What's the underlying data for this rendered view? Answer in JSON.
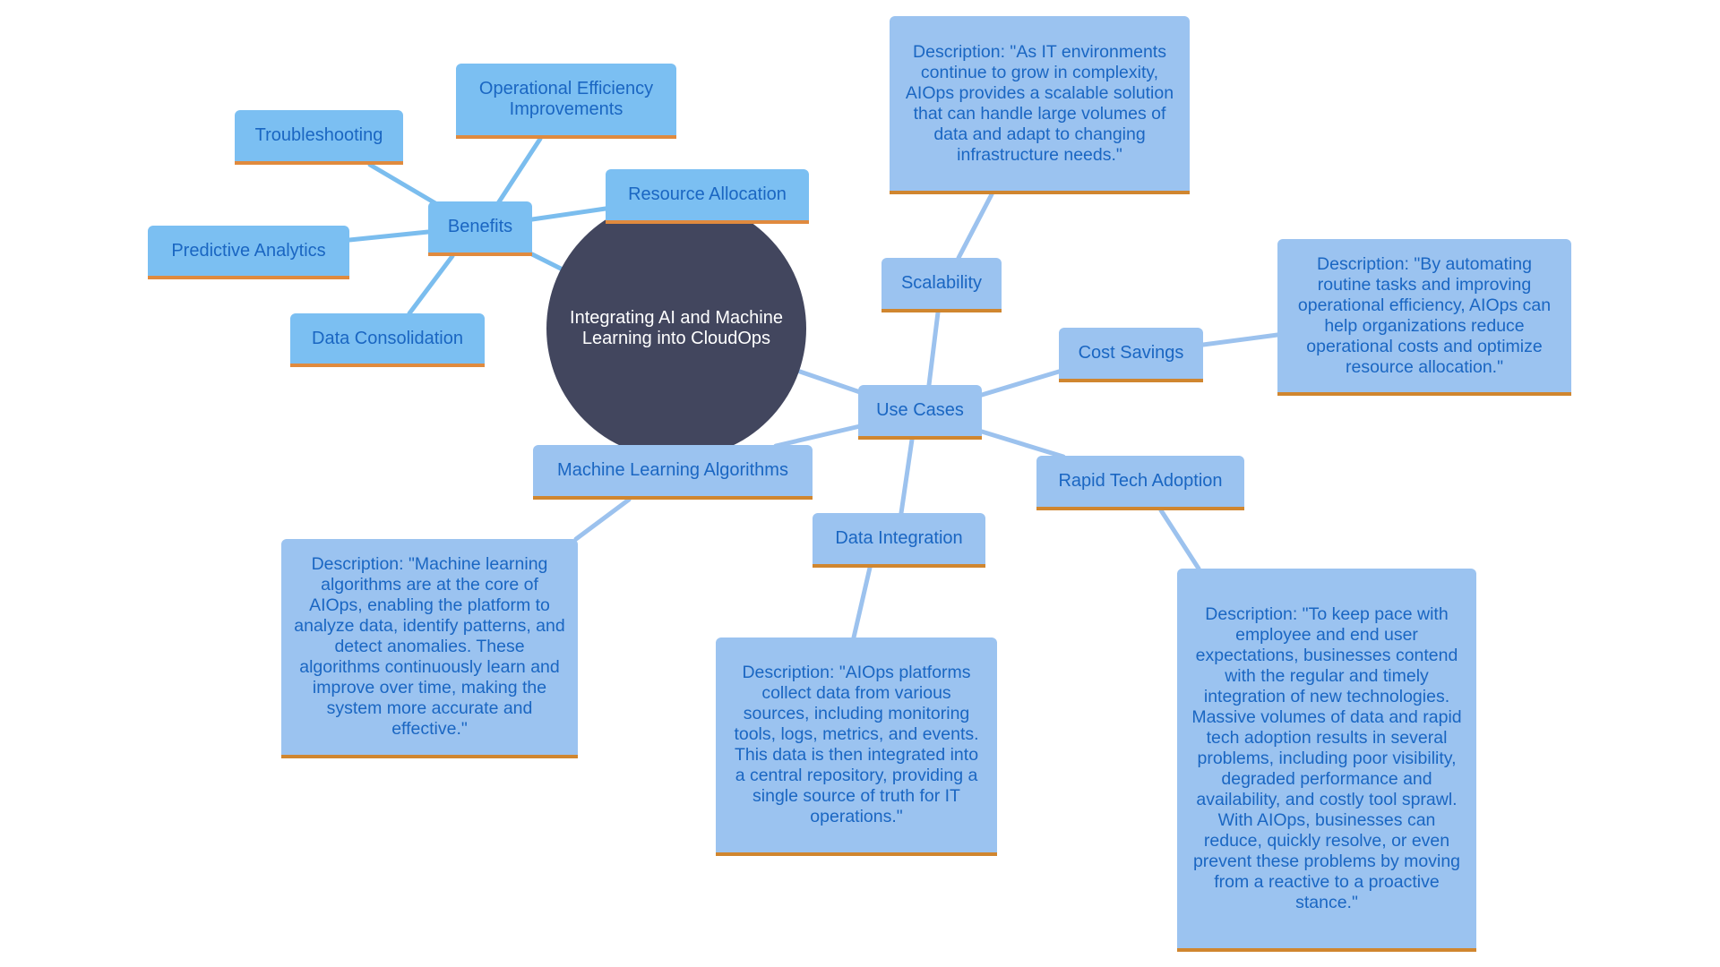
{
  "diagram": {
    "type": "mind-map",
    "center": {
      "label": "Integrating AI and Machine Learning into CloudOps"
    },
    "colors": {
      "center_fill": "#42465e",
      "center_text": "#ffffff",
      "benefit_fill": "#7bbff2",
      "usecase_fill": "#9bc3f0",
      "node_text": "#1a66c2",
      "accent_border": "#d4832f",
      "benefit_edge": "#7bbdee",
      "usecase_edge": "#9cc2ee"
    },
    "benefits": {
      "label": "Benefits",
      "children": [
        {
          "label": "Troubleshooting"
        },
        {
          "label": "Operational Efficiency Improvements"
        },
        {
          "label": "Resource Allocation"
        },
        {
          "label": "Predictive Analytics"
        },
        {
          "label": "Data Consolidation"
        }
      ]
    },
    "use_cases": {
      "label": "Use Cases",
      "children": [
        {
          "label": "Scalability",
          "description": "Description: \"As IT environments continue to grow in complexity, AIOps provides a scalable solution that can handle large volumes of data and adapt to changing infrastructure needs.\""
        },
        {
          "label": "Cost Savings",
          "description": "Description: \"By automating routine tasks and improving operational efficiency, AIOps can help organizations reduce operational costs and optimize resource allocation.\""
        },
        {
          "label": "Rapid Tech Adoption",
          "description": "Description: \"To keep pace with employee and end user expectations, businesses contend with the regular and timely integration of new technologies. Massive volumes of data and rapid tech adoption results in several problems, including poor visibility, degraded performance and availability, and costly tool sprawl. With AIOps, businesses can reduce, quickly resolve, or even prevent these problems by moving from a reactive to a proactive stance.\""
        },
        {
          "label": "Data Integration",
          "description": "Description: \"AIOps platforms collect data from various sources, including monitoring tools, logs, metrics, and events. This data is then integrated into a central repository, providing a single source of truth for IT operations.\""
        },
        {
          "label": "Machine Learning Algorithms",
          "description": "Description: \"Machine learning algorithms are at the core of AIOps, enabling the platform to analyze data, identify patterns, and detect anomalies. These algorithms continuously learn and improve over time, making the system more accurate and effective.\""
        }
      ]
    }
  }
}
